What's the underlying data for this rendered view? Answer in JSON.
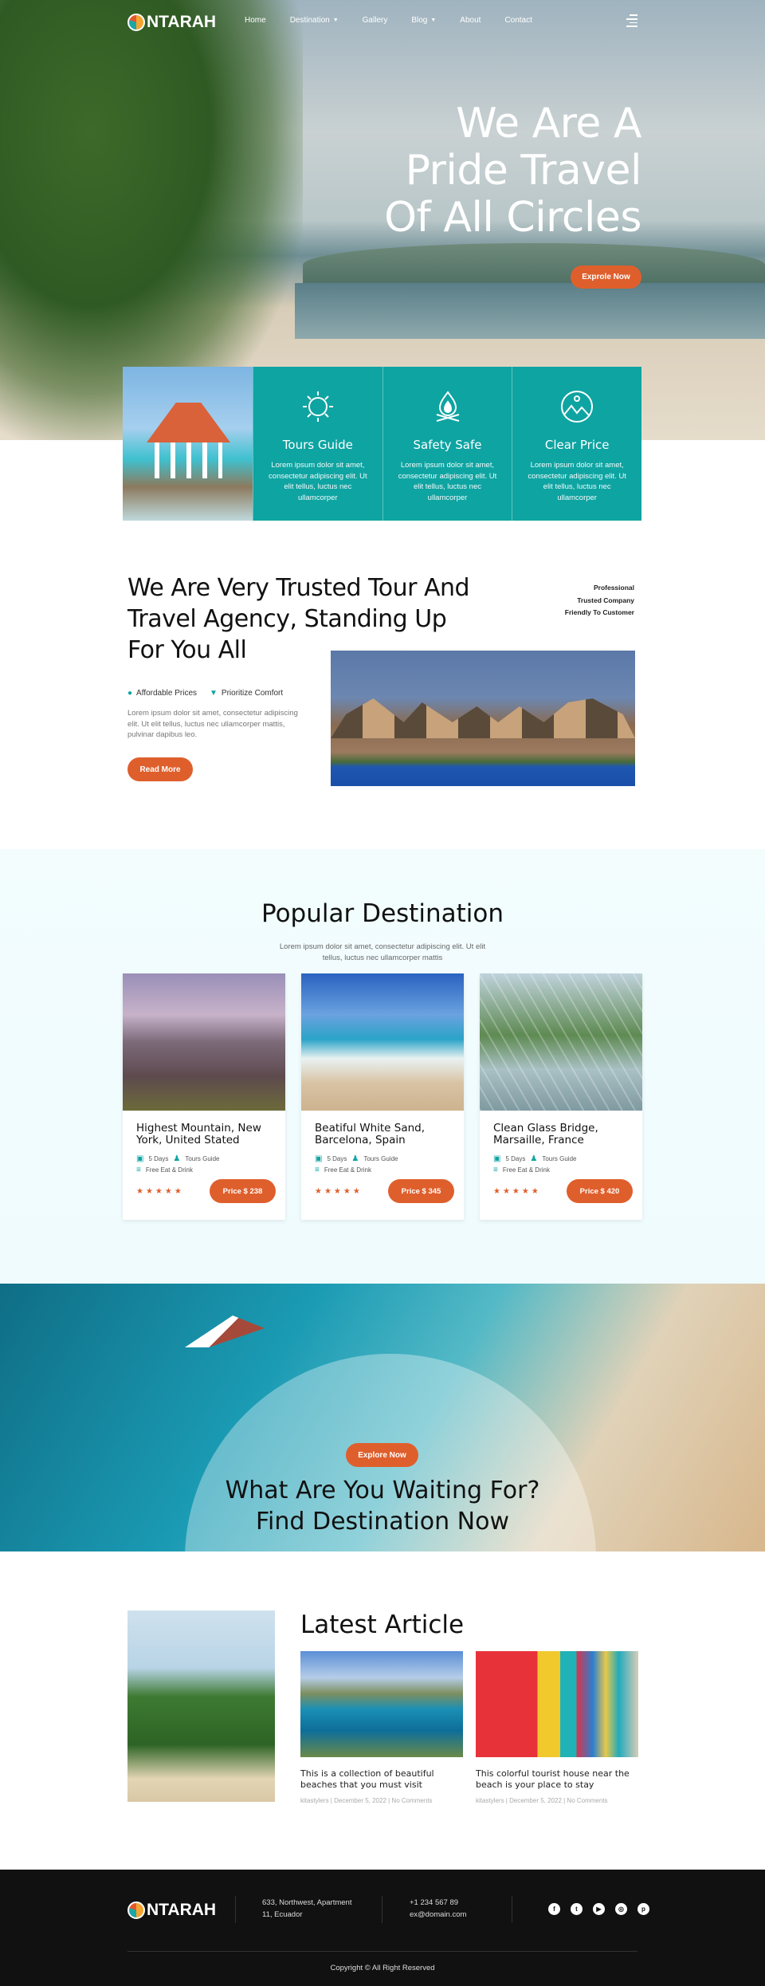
{
  "brand": {
    "name": "NTARAH"
  },
  "nav": {
    "items": [
      "Home",
      "Destination",
      "Gallery",
      "Blog",
      "About",
      "Contact"
    ]
  },
  "hero": {
    "title_lines": [
      "We Are A",
      "Pride Travel",
      "Of All Circles"
    ],
    "button": "Exprole Now"
  },
  "features": [
    {
      "icon": "sun-icon",
      "title": "Tours Guide",
      "text": "Lorem ipsum dolor sit amet, consectetur adipiscing elit. Ut elit tellus, luctus nec ullamcorper"
    },
    {
      "icon": "campfire-icon",
      "title": "Safety Safe",
      "text": "Lorem ipsum dolor sit amet, consectetur adipiscing elit. Ut elit tellus, luctus nec ullamcorper"
    },
    {
      "icon": "mountain-icon",
      "title": "Clear Price",
      "text": "Lorem ipsum dolor sit amet, consectetur adipiscing elit. Ut elit tellus, luctus nec ullamcorper"
    }
  ],
  "trusted": {
    "title": "We Are Very Trusted Tour And Travel Agency, Standing Up For You All",
    "list": [
      "Professional",
      "Trusted Company",
      "Friendly To Customer"
    ],
    "checks": [
      "Affordable Prices",
      "Prioritize Comfort"
    ],
    "text": "Lorem ipsum dolor sit amet, consectetur adipiscing elit. Ut elit tellus, luctus nec ullamcorper mattis, pulvinar dapibus leo.",
    "button": "Read More"
  },
  "popular": {
    "title": "Popular Destination",
    "subtitle": "Lorem ipsum dolor sit amet, consectetur adipiscing elit. Ut elit tellus, luctus nec ullamcorper mattis",
    "cards": [
      {
        "title": "Highest Mountain, New York, United Stated",
        "days": "5 Days",
        "guide": "Tours Guide",
        "food": "Free Eat & Drink",
        "rating": 5,
        "price": "Price $ 238"
      },
      {
        "title": "Beatiful White Sand, Barcelona, Spain",
        "days": "5 Days",
        "guide": "Tours Guide",
        "food": "Free Eat & Drink",
        "rating": 5,
        "price": "Price $ 345"
      },
      {
        "title": "Clean Glass Bridge, Marsaille, France",
        "days": "5 Days",
        "guide": "Tours Guide",
        "food": "Free Eat & Drink",
        "rating": 5,
        "price": "Price $ 420"
      }
    ]
  },
  "cta": {
    "button": "Explore Now",
    "title_lines": [
      "What Are You Waiting For?",
      "Find Destination Now"
    ]
  },
  "articles": {
    "title": "Latest Article",
    "items": [
      {
        "title": "This is a collection of beautiful beaches that you must visit",
        "meta": "kitastylers | December 5, 2022 | No Comments"
      },
      {
        "title": "This colorful tourist house near the beach is your place to stay",
        "meta": "kitastylers | December 5, 2022 | No Comments"
      }
    ]
  },
  "footer": {
    "address": [
      "633, Northwest, Apartment",
      "11, Ecuador"
    ],
    "phone": "+1 234 567 89",
    "email": "ex@domain.com",
    "social": [
      "facebook-icon",
      "twitter-icon",
      "youtube-icon",
      "instagram-icon",
      "pinterest-icon"
    ],
    "copyright": "Copyright © All Right Reserved"
  },
  "colors": {
    "accent": "#df5f2c",
    "teal": "#0ea4a2",
    "footer_bg": "#111111"
  }
}
